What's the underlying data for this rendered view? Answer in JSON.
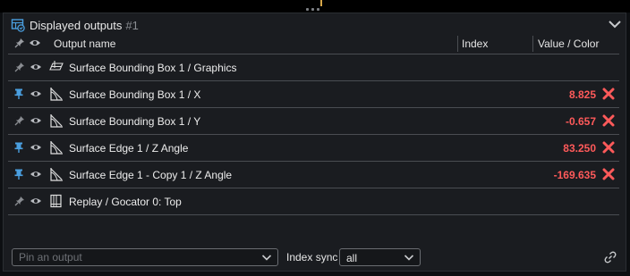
{
  "panel": {
    "title": "Displayed outputs",
    "title_number": "#1",
    "icon": "table-refresh-icon"
  },
  "columns": {
    "name": "Output name",
    "index": "Index",
    "value": "Value / Color"
  },
  "rows": [
    {
      "pinned": false,
      "type_icon": "plane-icon",
      "label": "Surface Bounding Box 1 / Graphics",
      "value": "",
      "deletable": false
    },
    {
      "pinned": true,
      "type_icon": "angle-measure-icon",
      "label": "Surface Bounding Box 1 / X",
      "value": "8.825",
      "deletable": true
    },
    {
      "pinned": false,
      "type_icon": "angle-measure-icon",
      "label": "Surface Bounding Box 1 / Y",
      "value": "-0.657",
      "deletable": true
    },
    {
      "pinned": true,
      "type_icon": "angle-measure-icon",
      "label": "Surface Edge 1 / Z Angle",
      "value": "83.250",
      "deletable": true
    },
    {
      "pinned": true,
      "type_icon": "angle-measure-icon",
      "label": "Surface Edge 1 - Copy 1 / Z Angle",
      "value": "-169.635",
      "deletable": true
    },
    {
      "pinned": false,
      "type_icon": "grid-frame-icon",
      "label": "Replay / Gocator 0: Top",
      "value": "",
      "deletable": false
    }
  ],
  "bottom": {
    "pin_placeholder": "Pin an output",
    "index_sync_label": "Index sync",
    "index_sync_value": "all"
  },
  "colors": {
    "accent_blue": "#4a9fe0",
    "value_red": "#ff5a5a",
    "background": "#1a1c20"
  }
}
